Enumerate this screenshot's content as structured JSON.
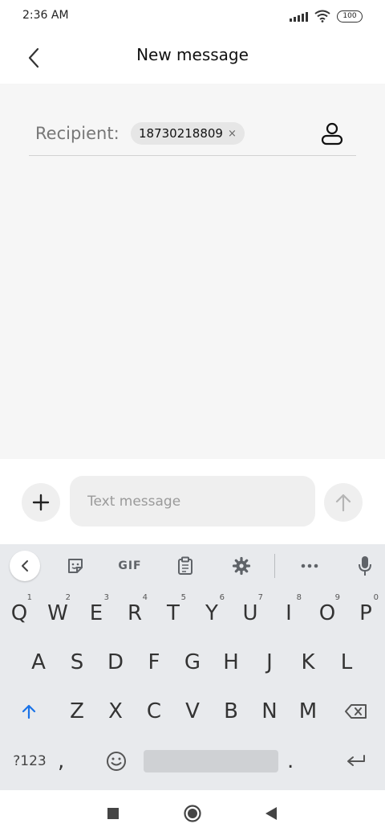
{
  "status_bar": {
    "time": "2:36 AM",
    "battery": "100"
  },
  "header": {
    "title": "New message"
  },
  "recipient": {
    "label": "Recipient:",
    "number": "18730218809",
    "remove_glyph": "×"
  },
  "composer": {
    "placeholder": "Text message"
  },
  "keyboard": {
    "toolbar": {
      "gif_label": "GIF"
    },
    "row1": [
      {
        "key": "Q",
        "hint": "1"
      },
      {
        "key": "W",
        "hint": "2"
      },
      {
        "key": "E",
        "hint": "3"
      },
      {
        "key": "R",
        "hint": "4"
      },
      {
        "key": "T",
        "hint": "5"
      },
      {
        "key": "Y",
        "hint": "6"
      },
      {
        "key": "U",
        "hint": "7"
      },
      {
        "key": "I",
        "hint": "8"
      },
      {
        "key": "O",
        "hint": "9"
      },
      {
        "key": "P",
        "hint": "0"
      }
    ],
    "row2": [
      "A",
      "S",
      "D",
      "F",
      "G",
      "H",
      "J",
      "K",
      "L"
    ],
    "row3": [
      "Z",
      "X",
      "C",
      "V",
      "B",
      "N",
      "M"
    ],
    "bottom": {
      "symbols_label": "?123",
      "comma": ",",
      "period": "."
    }
  },
  "colors": {
    "accent": "#1a73e8",
    "background": "#f6f6f6",
    "keyboard": "#e8eaed"
  },
  "icons": [
    "back-icon",
    "contact-icon",
    "plus-icon",
    "send-arrow-icon",
    "sticker-icon",
    "clipboard-icon",
    "settings-icon",
    "more-icon",
    "mic-icon",
    "shift-icon",
    "backspace-icon",
    "emoji-icon",
    "enter-icon",
    "recents-icon",
    "home-icon",
    "back-nav-icon"
  ]
}
